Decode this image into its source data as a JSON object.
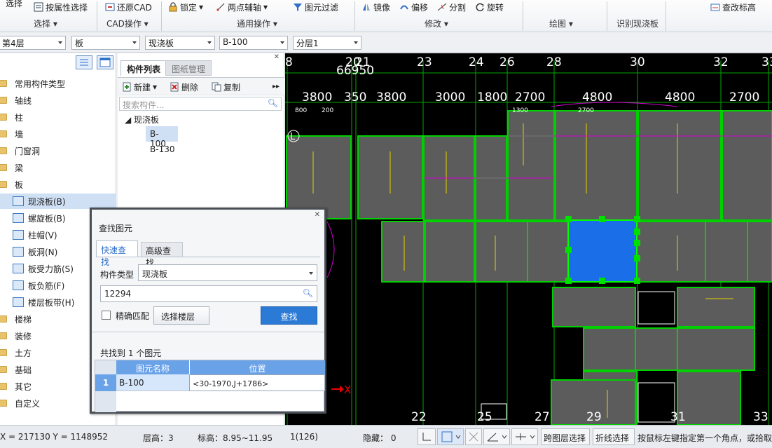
{
  "ribbon": {
    "top_left_clipped": "选择",
    "buttons": {
      "by_attr_select": "按属性选择",
      "restore_cad": "还原CAD",
      "lock": "锁定",
      "two_point_axis": "两点辅轴",
      "element_filter": "图元过滤",
      "mirror": "镜像",
      "offset": "偏移",
      "split": "分割",
      "rotate": "旋转",
      "check_elev": "查改标高"
    },
    "groups": {
      "select": "选择",
      "cad_ops": "CAD操作",
      "common_ops": "通用操作",
      "modify": "修改",
      "draw": "绘图",
      "identify_slab": "识别现浇板"
    }
  },
  "filters": {
    "floor": "第4层",
    "category": "板",
    "type": "现浇板",
    "component": "B-100",
    "sublayer": "分层1"
  },
  "tree": {
    "items": [
      {
        "label": "常用构件类型",
        "kind": "folder"
      },
      {
        "label": "轴线",
        "kind": "folder"
      },
      {
        "label": "柱",
        "kind": "folder"
      },
      {
        "label": "墙",
        "kind": "folder"
      },
      {
        "label": "门窗洞",
        "kind": "folder"
      },
      {
        "label": "梁",
        "kind": "folder"
      },
      {
        "label": "板",
        "kind": "folder"
      },
      {
        "label": "现浇板(B)",
        "kind": "sub",
        "selected": true
      },
      {
        "label": "螺旋板(B)",
        "kind": "sub"
      },
      {
        "label": "柱帽(V)",
        "kind": "sub"
      },
      {
        "label": "板洞(N)",
        "kind": "sub"
      },
      {
        "label": "板受力筋(S)",
        "kind": "sub"
      },
      {
        "label": "板负筋(F)",
        "kind": "sub"
      },
      {
        "label": "楼层板带(H)",
        "kind": "sub"
      },
      {
        "label": "楼梯",
        "kind": "folder"
      },
      {
        "label": "装修",
        "kind": "folder"
      },
      {
        "label": "土方",
        "kind": "folder"
      },
      {
        "label": "基础",
        "kind": "folder"
      },
      {
        "label": "其它",
        "kind": "folder"
      },
      {
        "label": "自定义",
        "kind": "folder"
      }
    ]
  },
  "complist": {
    "tab_list": "构件列表",
    "tab_drawings": "图纸管理",
    "new": "新建",
    "delete": "删除",
    "copy": "复制",
    "search_placeholder": "搜索构件...",
    "group": "现浇板",
    "items": [
      "B-100",
      "B-130"
    ]
  },
  "cad": {
    "dims_top": "66950",
    "axis_top": [
      "8",
      "20",
      "21",
      "23",
      "24",
      "26",
      "28",
      "30",
      "32",
      "33"
    ],
    "spans": [
      "3800",
      "350",
      "3800",
      "3000",
      "1800",
      "2700",
      "4800",
      "4800",
      "2700"
    ],
    "axis_bottom": [
      "22",
      "25",
      "27",
      "29",
      "31",
      "33"
    ],
    "left_label": "L",
    "x_axis_label": "X",
    "small_dims": [
      "800",
      "200",
      "1300",
      "2700"
    ]
  },
  "dialog": {
    "title": "查找图元",
    "tab_quick": "快速查找",
    "tab_adv": "高级查找",
    "type_label": "构件类型",
    "type_value": "现浇板",
    "search_value": "12294",
    "exact_match": "精确匹配",
    "select_floor": "选择楼层",
    "find": "查找",
    "result_text": "共找到 1 个图元",
    "col_name": "图元名称",
    "col_pos": "位置",
    "rows": [
      {
        "idx": "1",
        "name": "B-100",
        "pos": "<30-1970,J+1786>"
      }
    ]
  },
  "status": {
    "coords": "X = 217130 Y = 1148952",
    "floor_height": "层高：3",
    "elevation": "标高：8.95~11.95",
    "count": "1(126)",
    "hidden": "隐藏： 0",
    "cross_layer": "跨图层选择",
    "polyline_select": "折线选择",
    "hint": "按鼠标左键指定第一个角点，或拾取"
  }
}
